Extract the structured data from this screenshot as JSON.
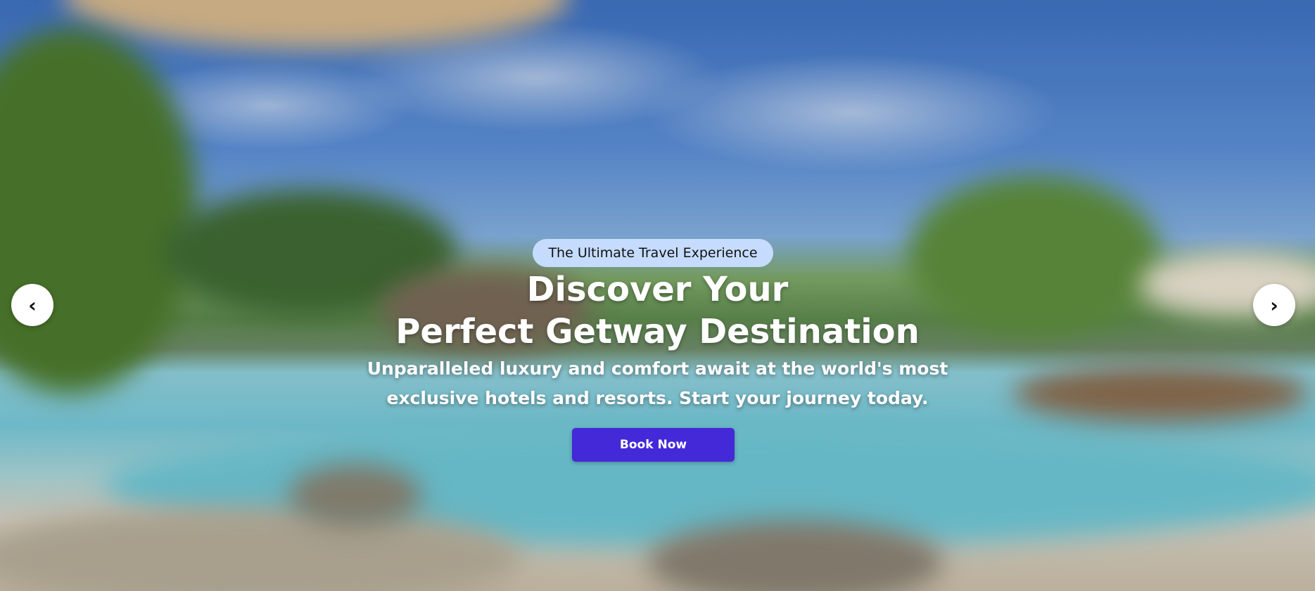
{
  "hero": {
    "badge": "The Ultimate Travel Experience",
    "headline_line1": "Discover Your",
    "headline_line2": "Perfect Getway Destination",
    "subtitle": "Unparalleled luxury and comfort await at the world's most exclusive hotels and resorts. Start your journey today.",
    "cta_label": "Book Now"
  },
  "carousel": {
    "prev_glyph": "‹",
    "next_glyph": "›"
  },
  "colors": {
    "badge_bg": "#c6dcff",
    "cta_bg": "#4329d8",
    "text": "#ffffff"
  },
  "icons": {
    "prev": "chevron-left-icon",
    "next": "chevron-right-icon"
  }
}
